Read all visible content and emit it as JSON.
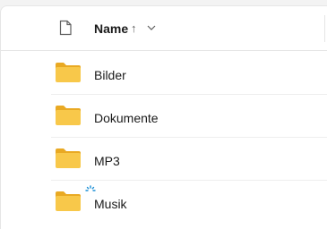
{
  "header": {
    "column_name": "Name",
    "sort_arrow": "↑",
    "file_icon": "file-icon",
    "sort_chevron_icon": "chevron-down-icon"
  },
  "rows": [
    {
      "label": "Bilder",
      "icon": "folder-icon"
    },
    {
      "label": "Dokumente",
      "icon": "folder-icon"
    },
    {
      "label": "MP3",
      "icon": "folder-icon"
    },
    {
      "label": "Musik",
      "icon": "folder-icon"
    }
  ],
  "colors": {
    "folder_body": "#f8c84a",
    "folder_tab": "#e9a923",
    "cursor_spinner": "#1e90d6"
  }
}
